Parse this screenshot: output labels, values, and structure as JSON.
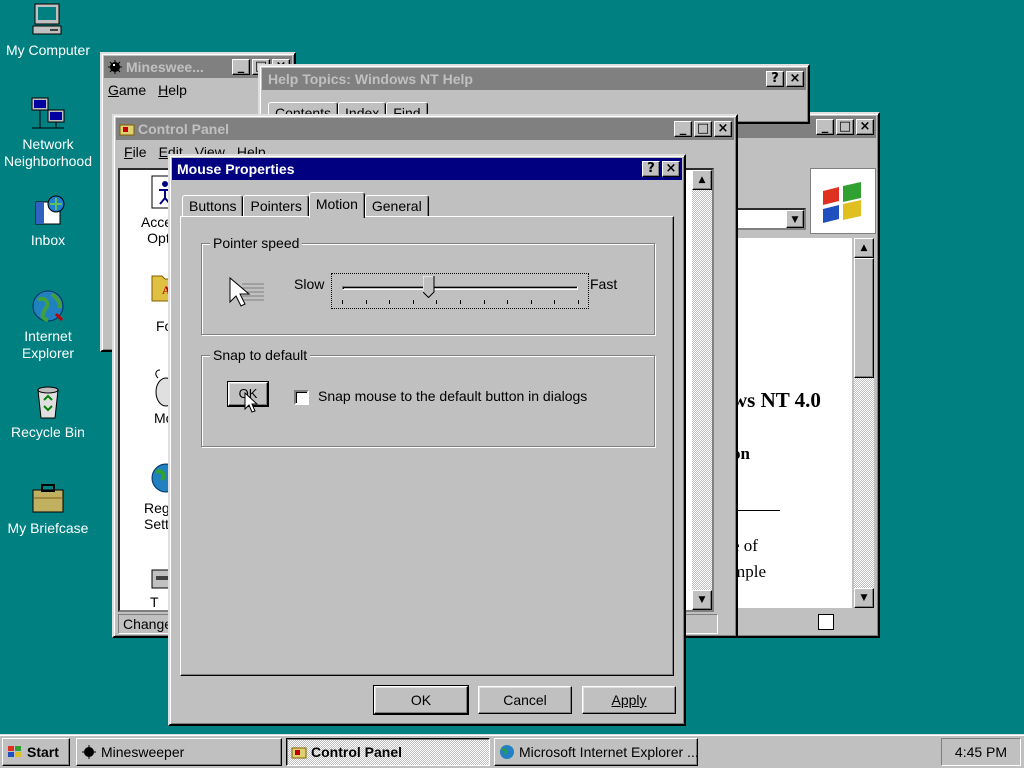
{
  "desktop": {
    "icons": [
      {
        "label": "My Computer",
        "icon": "computer-icon"
      },
      {
        "label": "Network Neighborhood",
        "icon": "network-icon"
      },
      {
        "label": "Inbox",
        "icon": "inbox-icon"
      },
      {
        "label": "Internet Explorer",
        "icon": "globe-icon"
      },
      {
        "label": "Recycle Bin",
        "icon": "recycle-bin-icon"
      },
      {
        "label": "My Briefcase",
        "icon": "briefcase-icon"
      }
    ],
    "background_color": "#008080"
  },
  "minesweeper": {
    "title": "Minesweeper",
    "title_display": "Mineswee...",
    "menu": [
      "Game",
      "Help"
    ]
  },
  "help": {
    "title": "Help Topics: Windows NT Help",
    "tabs": [
      "Contents",
      "Index",
      "Find"
    ]
  },
  "ie": {
    "title": "Microsoft Internet Explorer",
    "page_text_1": "ws NT 4.0",
    "page_text_2": "on",
    "page_text_3": "e of",
    "page_text_4": "mple"
  },
  "control_panel": {
    "title": "Control Panel",
    "menu": [
      "File",
      "Edit",
      "View",
      "Help"
    ],
    "items": [
      "Acces",
      "Opti",
      "For",
      "Mo",
      "Regi",
      "Sett",
      "T"
    ],
    "status": "Change"
  },
  "mouse_props": {
    "title": "Mouse Properties",
    "help_btn": "?",
    "close_btn": "×",
    "tabs": [
      "Buttons",
      "Pointers",
      "Motion",
      "General"
    ],
    "active_tab": "Motion",
    "pointer_speed": {
      "legend": "Pointer speed",
      "slow": "Slow",
      "fast": "Fast",
      "ticks": 11,
      "value_fraction": 0.37
    },
    "snap": {
      "legend": "Snap to default",
      "ok_preview": "OK",
      "checkbox_label": "Snap mouse to the default button in dialogs",
      "checked": false
    },
    "buttons": {
      "ok": "OK",
      "cancel": "Cancel",
      "apply": "Apply"
    }
  },
  "taskbar": {
    "start": "Start",
    "tasks": [
      {
        "label": "Minesweeper",
        "icon": "minesweeper-icon",
        "pressed": false
      },
      {
        "label": "Control Panel",
        "icon": "control-panel-icon",
        "pressed": true
      },
      {
        "label": "Microsoft Internet Explorer ...",
        "icon": "ie-icon",
        "pressed": false
      }
    ],
    "clock": "4:45 PM"
  }
}
